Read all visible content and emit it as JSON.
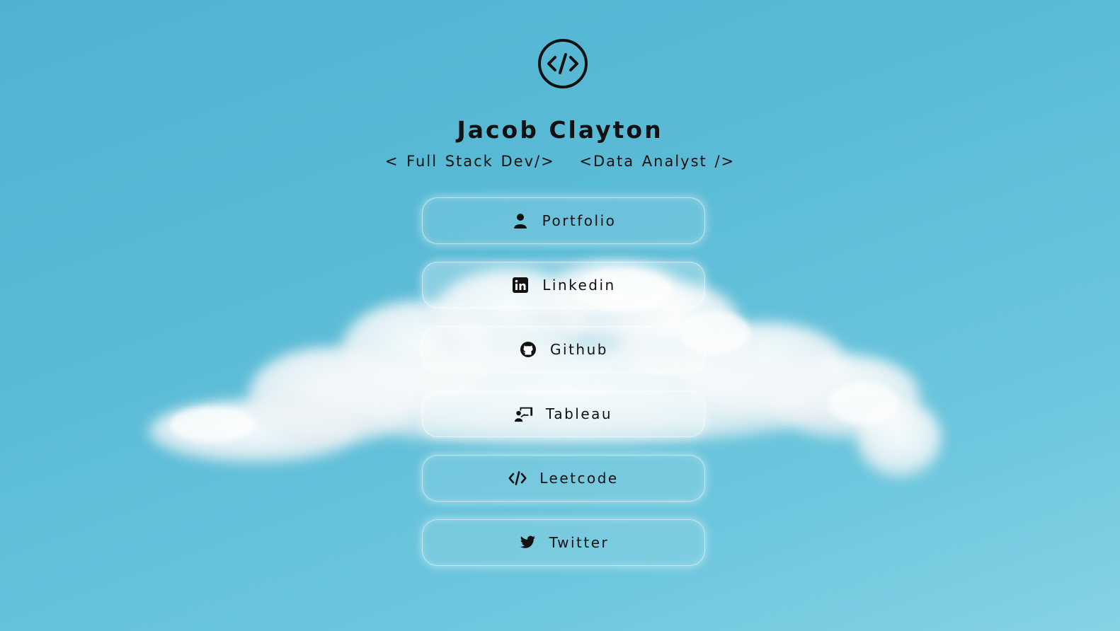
{
  "profile": {
    "name": "Jacob Clayton",
    "roles": [
      "< Full Stack Dev/>",
      "<Data Analyst />"
    ],
    "logo_icon": "code-circle-icon"
  },
  "links": [
    {
      "label": "Portfolio",
      "icon": "user-icon"
    },
    {
      "label": "Linkedin",
      "icon": "linkedin-icon"
    },
    {
      "label": "Github",
      "icon": "github-icon"
    },
    {
      "label": "Tableau",
      "icon": "presentation-icon"
    },
    {
      "label": "Leetcode",
      "icon": "code-icon"
    },
    {
      "label": "Twitter",
      "icon": "twitter-icon"
    }
  ],
  "colors": {
    "sky": "#5bbbd6",
    "text": "#111111",
    "button_border": "#ffffff"
  }
}
